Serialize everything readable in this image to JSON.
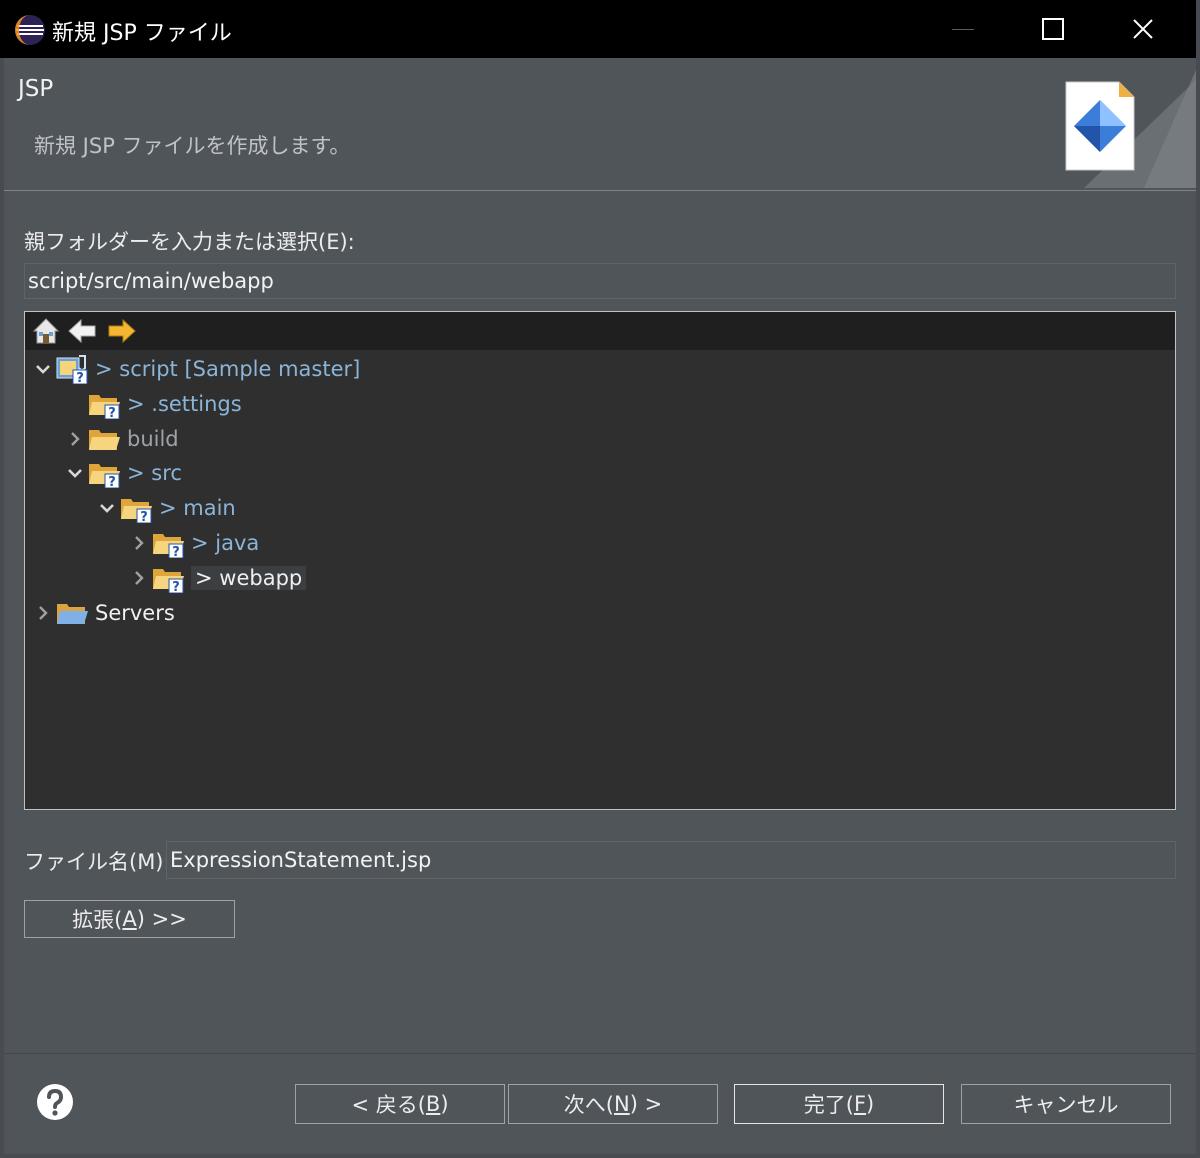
{
  "window": {
    "title": "新規 JSP ファイル"
  },
  "banner": {
    "title": "JSP",
    "description": "新規 JSP ファイルを作成します。"
  },
  "parent_folder": {
    "label": "親フォルダーを入力または選択(E):",
    "value": "script/src/main/webapp"
  },
  "tree": {
    "toolbar_icons": [
      "home-icon",
      "back-arrow-icon",
      "forward-arrow-icon"
    ],
    "items": [
      {
        "label": "> script [Sample master]",
        "depth": 0,
        "expanded": true,
        "icon": "project-icon"
      },
      {
        "label": "> .settings",
        "depth": 1,
        "expanded": null,
        "icon": "folder-unversioned-icon"
      },
      {
        "label": "build",
        "depth": 1,
        "expanded": false,
        "icon": "folder-icon"
      },
      {
        "label": "> src",
        "depth": 1,
        "expanded": true,
        "icon": "folder-unversioned-icon"
      },
      {
        "label": "> main",
        "depth": 2,
        "expanded": true,
        "icon": "folder-unversioned-icon"
      },
      {
        "label": "> java",
        "depth": 3,
        "expanded": false,
        "icon": "folder-unversioned-icon"
      },
      {
        "label": "> webapp",
        "depth": 3,
        "expanded": false,
        "icon": "folder-unversioned-icon",
        "selected": true
      },
      {
        "label": "Servers",
        "depth": 0,
        "expanded": false,
        "icon": "folder-open-icon"
      }
    ]
  },
  "file_name": {
    "label": "ファイル名(M):",
    "value": "ExpressionStatement.jsp"
  },
  "advanced_button": {
    "prefix": "拡張(",
    "mnemonic": "A",
    "suffix": ") >>"
  },
  "buttons": {
    "back": {
      "prefix": "< 戻る(",
      "mnemonic": "B",
      "suffix": ")"
    },
    "next": {
      "prefix": "次へ(",
      "mnemonic": "N",
      "suffix": ") >"
    },
    "finish": {
      "prefix": "完了(",
      "mnemonic": "F",
      "suffix": ")"
    },
    "cancel": "キャンセル"
  },
  "colors": {
    "dialog_bg": "#50555a",
    "tree_bg": "#2f2f2f",
    "vcs_label": "#8ab4d8",
    "titlebar_bg": "#000000"
  }
}
